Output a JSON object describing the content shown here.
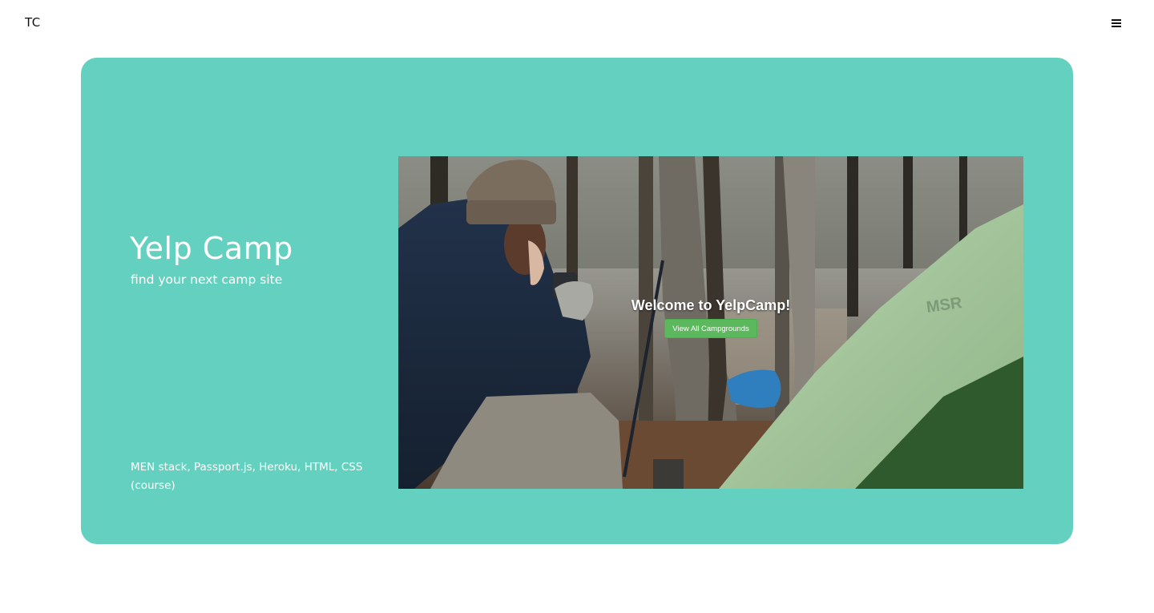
{
  "header": {
    "logo_text": "TC",
    "menu_icon": "hamburger-menu-icon"
  },
  "project": {
    "title": "Yelp Camp",
    "subtitle": "find your next camp site",
    "tech_stack": "MEN stack, Passport.js, Heroku, HTML, CSS (course)",
    "card_color": "#64d0bf"
  },
  "preview": {
    "heading": "Welcome to YelpCamp!",
    "button_label": "View All Campgrounds",
    "button_color": "#5cb85c",
    "tent_brand": "MSR"
  }
}
